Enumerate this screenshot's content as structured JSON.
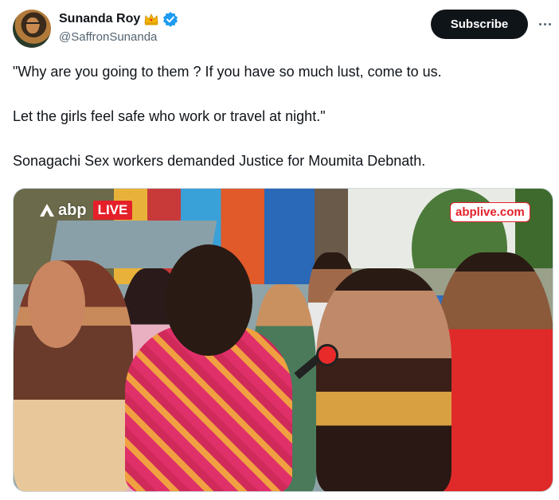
{
  "author": {
    "display_name": "Sunanda Roy",
    "handle": "@SaffronSunanda",
    "avatar_icon": "profile-photo-avatar",
    "badges": [
      "crown-icon",
      "verified-icon"
    ],
    "verified_color": "#1d9bf0",
    "crown_color": "#f4b400"
  },
  "actions": {
    "subscribe_label": "Subscribe",
    "more_icon": "more-options-icon"
  },
  "tweet": {
    "paragraphs": [
      "\"Why are you going to them ? If you have so much lust, come to us.",
      "Let the girls feel safe who work or travel at night.\"",
      "Sonagachi Sex workers demanded Justice for Moumita Debnath."
    ]
  },
  "media": {
    "type": "video-still",
    "brand": "abp",
    "live_label": "LIVE",
    "site": "abplive.com",
    "accent": "#e4202a"
  }
}
